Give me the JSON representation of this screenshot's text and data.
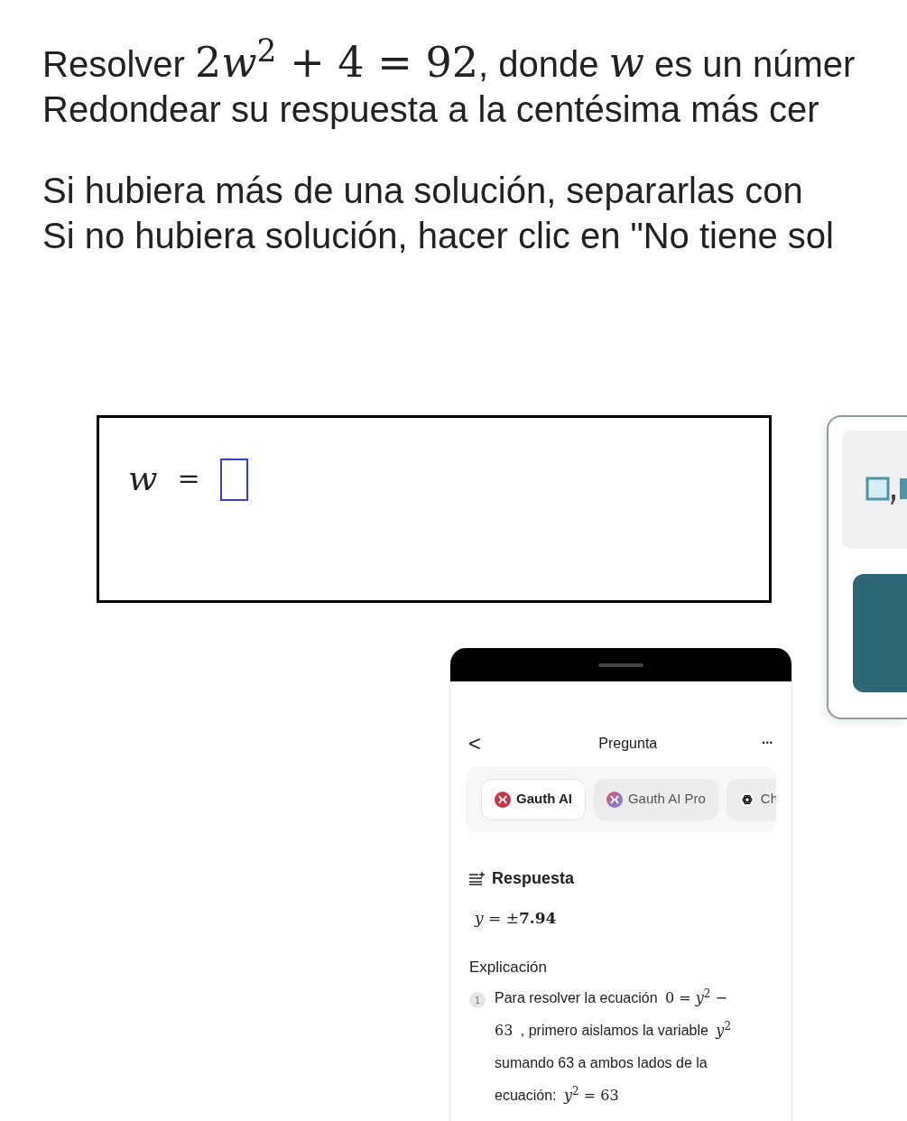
{
  "question": {
    "lines": [
      [
        {
          "kind": "text",
          "text": "Resolver "
        },
        {
          "kind": "math",
          "text": "2"
        },
        {
          "kind": "math",
          "text": "*w*$^{2}$ + 4 = 92"
        },
        {
          "kind": "text",
          "text": ", donde "
        },
        {
          "kind": "math",
          "text": "*w*"
        },
        {
          "kind": "text",
          "text": " es un númer"
        }
      ],
      [
        {
          "kind": "text",
          "text": "Redondear su respuesta a la centésima más cer"
        }
      ],
      [
        {
          "kind": "text",
          "text": "Si hubiera más de una solución, separarlas con"
        }
      ],
      [
        {
          "kind": "text",
          "text": "Si no hubiera solución, hacer clic en \"No tiene sol"
        }
      ]
    ]
  },
  "answer": {
    "variable": "*w*",
    "equals": "="
  },
  "phone": {
    "header": {
      "back": "<",
      "title": "Pregunta",
      "more": "•••"
    },
    "tabs": [
      {
        "label": "Gauth AI",
        "selected": true,
        "kind": "gauth"
      },
      {
        "label": "Gauth AI Pro",
        "selected": false,
        "kind": "pro"
      },
      {
        "label": "Ch",
        "selected": false,
        "kind": "chat"
      }
    ],
    "answer_heading": "Respuesta",
    "answer_value": "*y* = ±**7.94**",
    "explanation_heading": "Explicación",
    "steps": [
      {
        "number": "1",
        "segments": [
          {
            "kind": "text",
            "text": "Para resolver la ecuación "
          },
          {
            "kind": "math",
            "text": "0 = *y*$^{2}$ − 63"
          },
          {
            "kind": "text",
            "text": " , primero aislamos la variable "
          },
          {
            "kind": "math",
            "text": "*y*$^{2}$"
          },
          {
            "kind": "text",
            "text": " sumando 63 a ambos lados de la ecuación: "
          },
          {
            "kind": "math",
            "text": "*y*$^{2}$ = 63"
          }
        ]
      }
    ]
  }
}
